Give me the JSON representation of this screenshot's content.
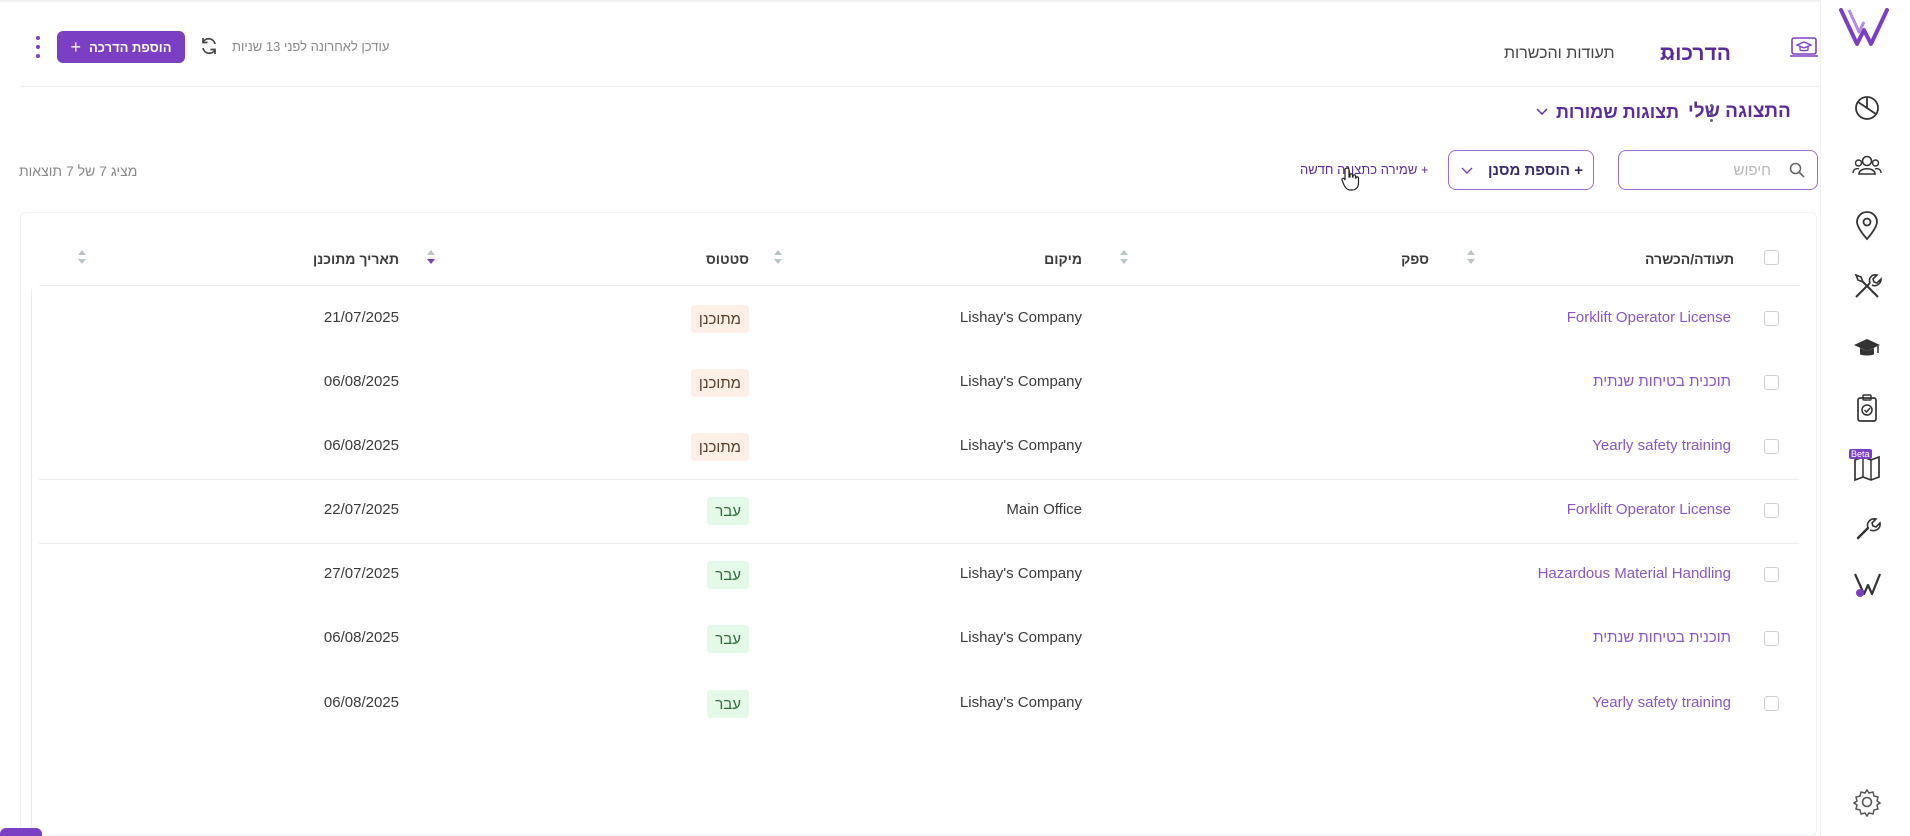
{
  "header": {
    "tab_trainings": "הדרכות",
    "tab_certifications": "תעודות והכשרות",
    "last_updated": "עודכן לאחרונה לפני 13 שניות",
    "add_training_label": "הוספת הדרכה"
  },
  "views": {
    "my_view": "התצוגה שלי",
    "saved_views": "תצוגות שמורות"
  },
  "filters": {
    "search_placeholder": "חיפוש",
    "add_filter_label": "+ הוספת מסנן",
    "save_view_label": "+ שמירה כתצוגה חדשה",
    "results_text": "מציג 7 של 7 תוצאות"
  },
  "table": {
    "columns": {
      "certification": "תעודה/הכשרה",
      "supplier": "ספק",
      "location": "מיקום",
      "status": "סטטוס",
      "planned_date": "תאריך מתוכנן"
    },
    "rows": [
      {
        "certification": "Forklift Operator License",
        "supplier": "",
        "location": "Lishay's Company",
        "status": "מתוכנן",
        "status_type": "planned",
        "planned_date": "21/07/2025"
      },
      {
        "certification": "תוכנית בטיחות שנתית",
        "supplier": "",
        "location": "Lishay's Company",
        "status": "מתוכנן",
        "status_type": "planned",
        "planned_date": "06/08/2025"
      },
      {
        "certification": "Yearly safety training",
        "supplier": "",
        "location": "Lishay's Company",
        "status": "מתוכנן",
        "status_type": "planned",
        "planned_date": "06/08/2025"
      },
      {
        "certification": "Forklift Operator License",
        "supplier": "",
        "location": "Main Office",
        "status": "עבר",
        "status_type": "passed",
        "planned_date": "22/07/2025"
      },
      {
        "certification": "Hazardous Material Handling",
        "supplier": "",
        "location": "Lishay's Company",
        "status": "עבר",
        "status_type": "passed",
        "planned_date": "27/07/2025"
      },
      {
        "certification": "תוכנית בטיחות שנתית",
        "supplier": "",
        "location": "Lishay's Company",
        "status": "עבר",
        "status_type": "passed",
        "planned_date": "06/08/2025"
      },
      {
        "certification": "Yearly safety training",
        "supplier": "",
        "location": "Lishay's Company",
        "status": "עבר",
        "status_type": "passed",
        "planned_date": "06/08/2025"
      }
    ]
  },
  "sidenav": {
    "beta_label": "Beta",
    "items": [
      "dashboard-icon",
      "people-icon",
      "location-pin-icon",
      "tools-icon",
      "graduation-cap-icon",
      "clipboard-check-icon",
      "map-icon",
      "wrench-icon",
      "brand-v-icon",
      "settings-icon"
    ]
  },
  "colors": {
    "accent": "#7b3fc4",
    "accent_dark": "#5b2b9c",
    "link": "#8a55c8",
    "planned_bg": "#fdeee6",
    "passed_bg": "#e4f9e7"
  }
}
